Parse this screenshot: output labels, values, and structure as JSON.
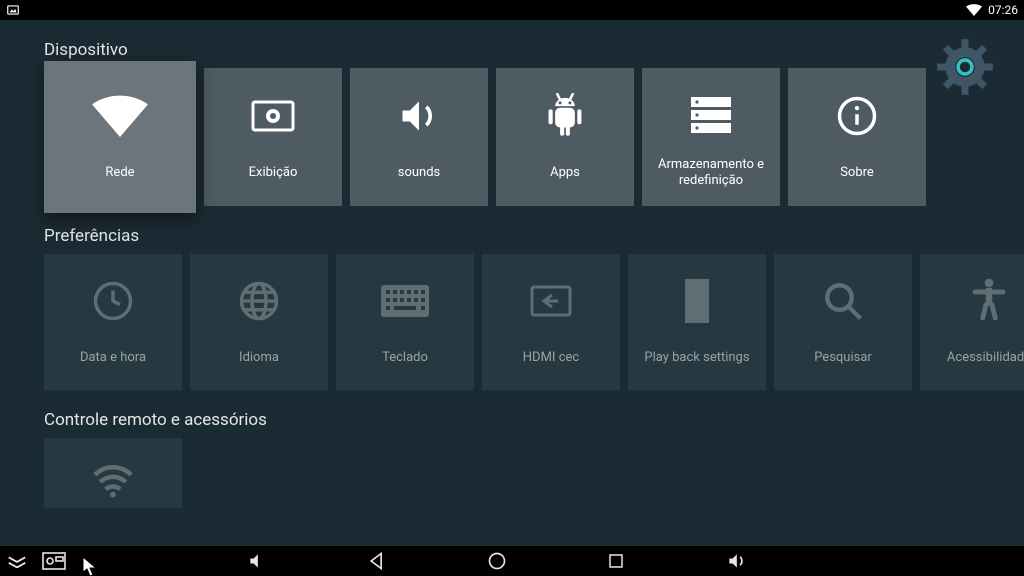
{
  "statusbar": {
    "time": "07:26"
  },
  "gear": {
    "name": "settings-gear-icon"
  },
  "sections": [
    {
      "title": "Dispositivo",
      "tiles": [
        {
          "label": "Rede",
          "icon": "wifi",
          "selected": true
        },
        {
          "label": "Exibição",
          "icon": "display"
        },
        {
          "label": "sounds",
          "icon": "volume"
        },
        {
          "label": "Apps",
          "icon": "apps"
        },
        {
          "label": "Armazenamento e\nredefinição",
          "icon": "storage"
        },
        {
          "label": "Sobre",
          "icon": "info"
        }
      ]
    },
    {
      "title": "Preferências",
      "dim": true,
      "tiles": [
        {
          "label": "Data e hora",
          "icon": "clock"
        },
        {
          "label": "Idioma",
          "icon": "globe"
        },
        {
          "label": "Teclado",
          "icon": "keyboard"
        },
        {
          "label": "HDMI cec",
          "icon": "hdmi"
        },
        {
          "label": "Play back settings",
          "icon": "film"
        },
        {
          "label": "Pesquisar",
          "icon": "search"
        },
        {
          "label": "Acessibilidade",
          "icon": "accessibility"
        }
      ]
    },
    {
      "title": "Controle remoto e acessórios",
      "dim": true,
      "tiles": [
        {
          "label": "",
          "icon": "wifi-dim"
        }
      ]
    }
  ],
  "colors": {
    "bg": "#1b2b34",
    "tile": "#4f5b62",
    "tileSelected": "#6b757b",
    "tileDim": "#263840",
    "gearAccent": "#36c1c7",
    "gearBody": "#3e5666"
  }
}
